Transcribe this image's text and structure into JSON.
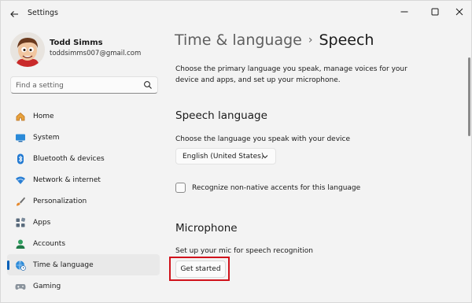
{
  "window": {
    "title": "Settings",
    "controls": [
      "minimize-icon",
      "maximize-icon",
      "close-icon"
    ]
  },
  "user": {
    "name": "Todd Simms",
    "email": "toddsimms007@gmail.com"
  },
  "search": {
    "placeholder": "Find a setting"
  },
  "sidebar": {
    "items": [
      {
        "label": "Home",
        "icon": "home-icon",
        "selected": false
      },
      {
        "label": "System",
        "icon": "system-icon",
        "selected": false
      },
      {
        "label": "Bluetooth & devices",
        "icon": "bluetooth-icon",
        "selected": false
      },
      {
        "label": "Network & internet",
        "icon": "wifi-icon",
        "selected": false
      },
      {
        "label": "Personalization",
        "icon": "brush-icon",
        "selected": false
      },
      {
        "label": "Apps",
        "icon": "apps-icon",
        "selected": false
      },
      {
        "label": "Accounts",
        "icon": "person-icon",
        "selected": false
      },
      {
        "label": "Time & language",
        "icon": "globe-clock-icon",
        "selected": true
      },
      {
        "label": "Gaming",
        "icon": "gamepad-icon",
        "selected": false
      }
    ]
  },
  "breadcrumb": {
    "parent": "Time & language",
    "separator": "›",
    "current": "Speech"
  },
  "main": {
    "description": "Choose the primary language you speak, manage voices for your device and apps, and set up your microphone.",
    "speech_language": {
      "heading": "Speech language",
      "label": "Choose the language you speak with your device",
      "selected_value": "English (United States)",
      "checkbox_label": "Recognize non-native accents for this language",
      "checkbox_checked": false
    },
    "microphone": {
      "heading": "Microphone",
      "label": "Set up your mic for speech recognition",
      "button_label": "Get started"
    }
  },
  "colors": {
    "accent": "#005fb8",
    "highlight_box": "#d0121b",
    "background": "#f3f3f3"
  }
}
